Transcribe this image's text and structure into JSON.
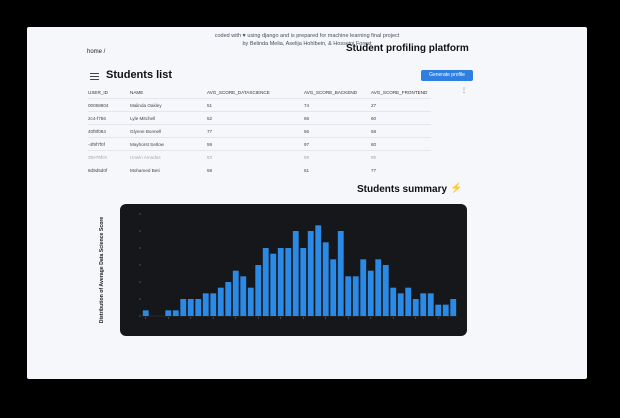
{
  "credit": {
    "line1": "coded with ♥ using django and is prepared for machine learning final project",
    "line2": "by Belinda Melia, Aselija Hohlbein, & Hosseini Forest"
  },
  "breadcrumb": "home /",
  "brand": "Student profiling platform",
  "students_list": {
    "title": "Students list",
    "generate_button": "Generate profile",
    "columns": [
      "USER_ID",
      "NAME",
      "AVG_SCORE_DATASCIENCE",
      "AVG_SCORE_BACKEND",
      "AVG_SCORE_FRONTEND"
    ],
    "rows": [
      [
        "00068804",
        "Malinda Oakley",
        "51",
        "74",
        "27"
      ],
      [
        "2c4-f786",
        "Lyle Mitchell",
        "52",
        "66",
        "60"
      ],
      [
        "40f8f084",
        "Glynne Bonnell",
        "77",
        "56",
        "58"
      ],
      [
        "-4f9f7f0f",
        "Mayhorst Setlow",
        "59",
        "97",
        "80"
      ],
      [
        "35e76fc6",
        "Unwin Amadas",
        "53",
        "68",
        "85"
      ],
      [
        "8d9d5d0f",
        "Mohamed Beti",
        "58",
        "61",
        "77"
      ]
    ]
  },
  "summary": {
    "title": "Students summary"
  },
  "colors": {
    "bar": "#2b8ae6",
    "panel": "#16171a",
    "accent": "#2f7fe0"
  },
  "chart_data": {
    "type": "bar",
    "ylabel": "Distribution of Average Data Science Score",
    "ylim": [
      0,
      18
    ],
    "values": [
      1,
      0,
      0,
      1,
      1,
      3,
      3,
      3,
      4,
      4,
      5,
      6,
      8,
      7,
      5,
      9,
      12,
      11,
      12,
      12,
      15,
      12,
      15,
      16,
      13,
      10,
      15,
      7,
      7,
      10,
      8,
      10,
      9,
      5,
      4,
      5,
      3,
      4,
      4,
      2,
      2,
      3
    ],
    "series_color": "#2b8ae6"
  }
}
